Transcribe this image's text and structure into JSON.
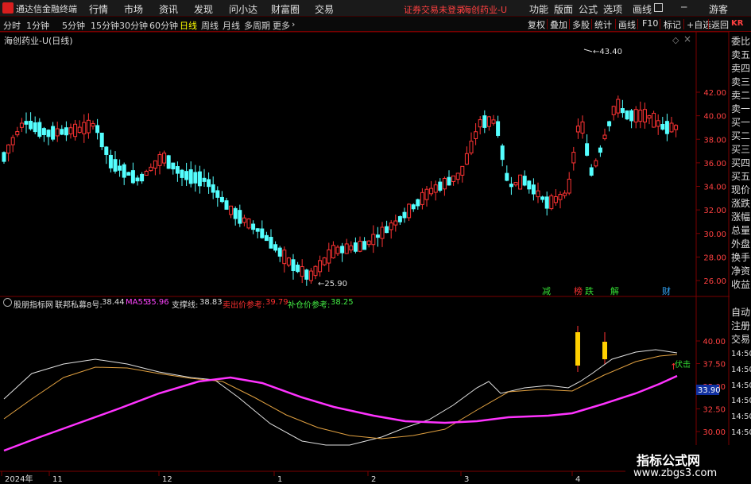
{
  "app": {
    "title": "通达信金融终端"
  },
  "menus": [
    "行情",
    "市场",
    "资讯",
    "发现",
    "问小达",
    "财富圈",
    "交易"
  ],
  "status": {
    "trade_login": "证券交易未登录",
    "stock_name": "海创药业-U"
  },
  "top_right": [
    "功能",
    "版面",
    "公式",
    "选项",
    "画线",
    "游客"
  ],
  "periods": [
    "分时",
    "1分钟",
    "5分钟",
    "15分钟",
    "30分钟",
    "60分钟",
    "日线",
    "周线",
    "月线",
    "多周期",
    "更多"
  ],
  "active_period": "日线",
  "tools": [
    "复权",
    "叠加",
    "多股",
    "统计",
    "画线",
    "F10",
    "标记",
    "+自选",
    "返回"
  ],
  "chart": {
    "title": "海创药业-U(日线)",
    "high_label": "43.40",
    "low_label": "25.90",
    "price_ticks": [
      "42.00",
      "40.00",
      "38.00",
      "36.00",
      "34.00",
      "32.00",
      "30.00",
      "28.00",
      "26.00"
    ],
    "signals": [
      {
        "text": "减",
        "color": "#33dd33"
      },
      {
        "text": "榜",
        "color": "#ff3333"
      },
      {
        "text": "跌",
        "color": "#33dd33"
      },
      {
        "text": "解",
        "color": "#33dd33"
      },
      {
        "text": "财",
        "color": "#33aaff"
      }
    ]
  },
  "indicator": {
    "name": "股朋指标网",
    "line1_label": "联邦私募8号:",
    "line1_value": "38.44",
    "line2_label": "MA55:",
    "line2_value": "35.96",
    "line3_label": "支撑线:",
    "line3_value": "38.83",
    "line4_label": "卖出价参考:",
    "line4_value": "39.79",
    "line5_label": "补仓价参考:",
    "line5_value": "38.25",
    "ticks": [
      "40.00",
      "37.50",
      "35.00",
      "32.50",
      "30.00"
    ],
    "current_value": "33.90",
    "signal_text": "伏击"
  },
  "time_axis": [
    "2024年",
    "11",
    "12",
    "1",
    "2",
    "3",
    "4"
  ],
  "side_panel": {
    "top_tag": "KR",
    "items": [
      "委比",
      "卖五",
      "卖四",
      "卖三",
      "卖二",
      "卖一",
      "买一",
      "买二",
      "买三",
      "买四",
      "买五",
      "现价",
      "涨跌",
      "涨幅",
      "总量",
      "外盘",
      "换手",
      "净资",
      "收益"
    ],
    "lower_items": [
      "自动",
      "注册",
      "交易"
    ],
    "times": [
      "14:50",
      "14:50",
      "14:50",
      "14:50",
      "14:50",
      "14:50",
      "14:50"
    ]
  },
  "watermark": {
    "line1": "指标公式网",
    "line2": "www.zbgs3.com"
  },
  "colors": {
    "up": "#ff3333",
    "down": "#54ffff",
    "ma55": "#ff33ff",
    "grid": "#7a0000"
  }
}
